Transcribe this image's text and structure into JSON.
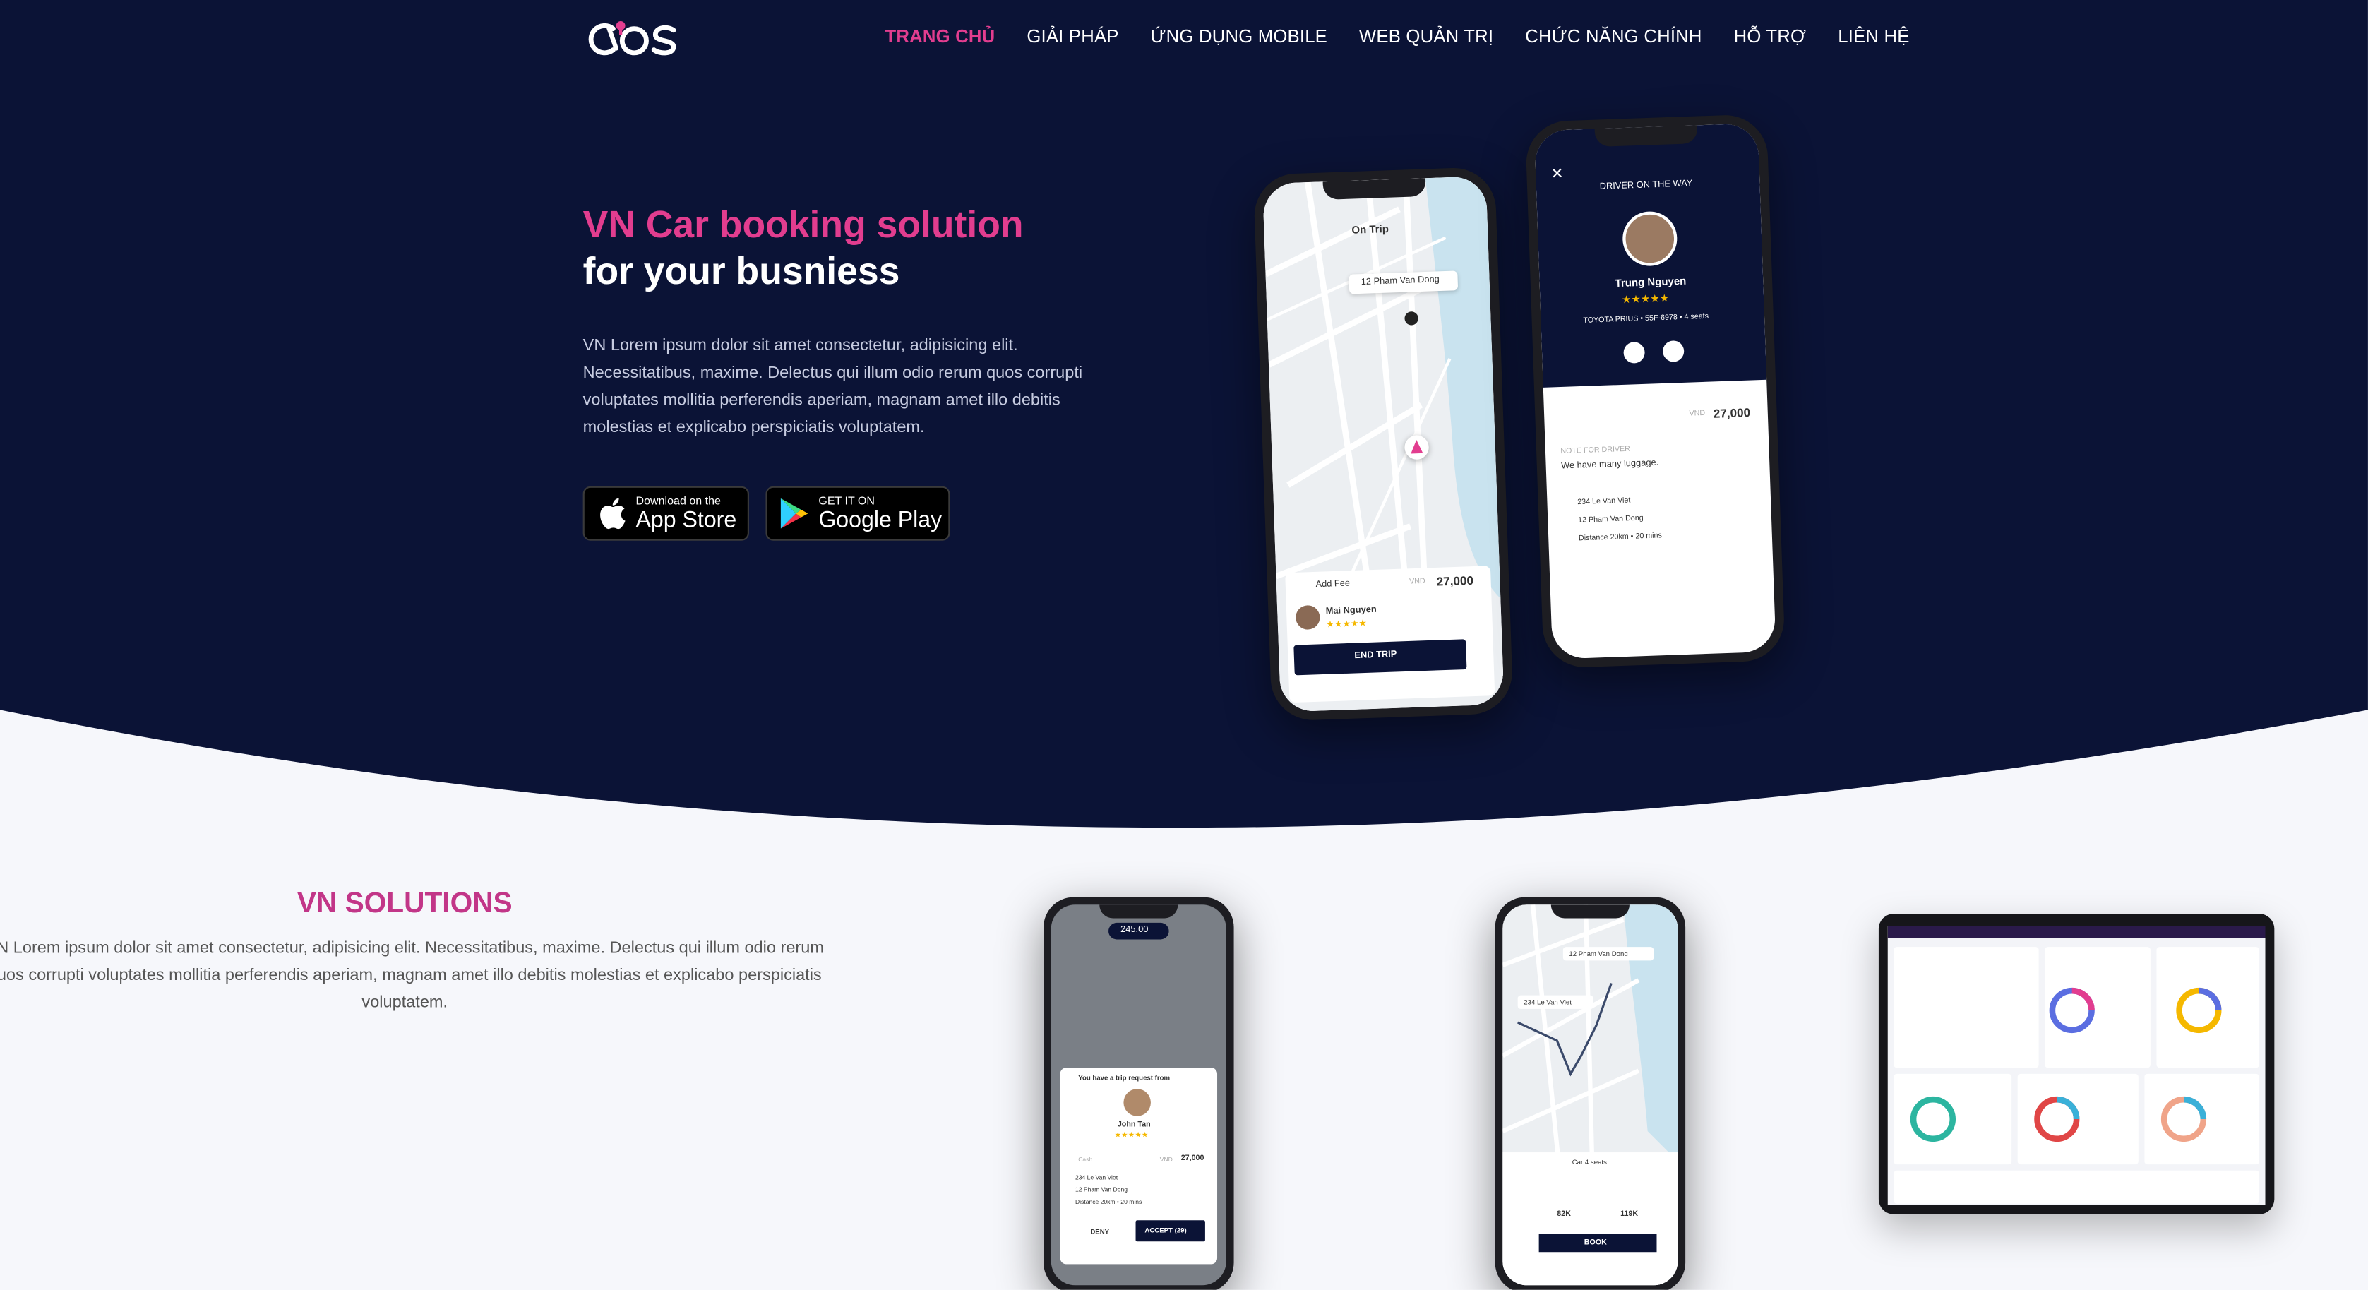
{
  "nav": {
    "items": [
      "TRANG CHỦ",
      "GIẢI PHÁP",
      "ỨNG DỤNG MOBILE",
      "WEB QUẢN TRỊ",
      "CHỨC NĂNG CHÍNH",
      "HỖ TRỢ",
      "LIÊN HỆ"
    ],
    "active_index": 0
  },
  "hero": {
    "title_line1": "VN Car booking solution",
    "title_line2": "for your busniess",
    "description": "VN Lorem ipsum dolor sit amet consectetur, adipisicing elit. Necessitatibus, maxime. Delectus qui illum odio rerum quos corrupti voluptates mollitia perferendis aperiam, magnam amet illo debitis molestias et explicabo perspiciatis voluptatem.",
    "app_store": {
      "small": "Download on the",
      "big": "App Store"
    },
    "google_play": {
      "small": "GET IT ON",
      "big": "Google Play"
    }
  },
  "phone_trip": {
    "status": "On Trip",
    "address": "12 Pham Van Dong",
    "add_fee": "Add Fee",
    "currency": "VND",
    "fare": "27,000",
    "driver_name": "Mai Nguyen",
    "end_trip": "END TRIP"
  },
  "phone_driver": {
    "header": "DRIVER ON THE WAY",
    "driver_name": "Trung Nguyen",
    "car_info": "TOYOTA PRIUS • 55F-6978 • 4 seats",
    "currency": "VND",
    "fare": "27,000",
    "note_label": "NOTE FOR DRIVER",
    "note": "We have many luggage.",
    "stops": [
      "234 Le Van Viet",
      "12 Pham Van Dong",
      "Distance 20km • 20 mins"
    ]
  },
  "solutions": {
    "title": "VN SOLUTIONS",
    "description": "VN Lorem ipsum dolor sit amet consectetur, adipisicing elit. Necessitatibus, maxime. Delectus qui illum odio rerum quos corrupti voluptates mollitia perferendis aperiam, magnam amet illo debitis molestias et explicabo perspiciatis voluptatem."
  },
  "phone_request": {
    "badge": "245.00",
    "title": "You have a trip request from",
    "rider": "John Tan",
    "payment": "Cash",
    "currency": "VND",
    "fare": "27,000",
    "stops": [
      "234 Le Van Viet",
      "12 Pham Van Dong",
      "Distance 20km • 20 mins"
    ],
    "deny": "DENY",
    "accept": "ACCEPT (29)"
  },
  "phone_book": {
    "dest": "12 Pham Van Dong",
    "origin": "234 Le Van Viet",
    "car": "Car 4 seats",
    "fare1": "82K",
    "fare2": "119K",
    "book": "BOOK"
  },
  "colors": {
    "navy": "#0b1336",
    "pink": "#e23d8f"
  }
}
